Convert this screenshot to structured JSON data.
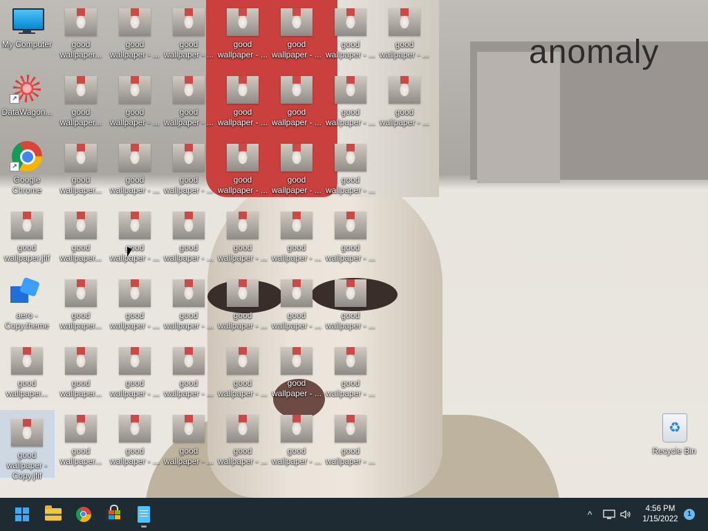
{
  "wallpaper": {
    "sign_text": "anomaly"
  },
  "desktop": {
    "special_icons": {
      "my_computer": "My Computer",
      "datawagon": "DataWagon...",
      "chrome": "Google Chrome",
      "jfif": "good wallpaper.jfif",
      "theme": "aero - Copy.theme",
      "col1_row6": "good wallpaper...",
      "col1_row7": "good wallpaper - Copy.jfif",
      "recycle_bin": "Recycle Bin"
    },
    "grid_labels": [
      [
        "good wallpaper...",
        "good wallpaper - ...",
        "good wallpaper - ...",
        "good wallpaper - ...",
        "good wallpaper - ...",
        "good wallpaper - ...",
        "good wallpaper - ..."
      ],
      [
        "good wallpaper...",
        "good wallpaper - ...",
        "good wallpaper - ...",
        "good wallpaper - ...",
        "good wallpaper - ...",
        "good wallpaper - ...",
        "good wallpaper - ..."
      ],
      [
        "good wallpaper...",
        "good wallpaper - ...",
        "good wallpaper - ...",
        "good wallpaper - ...",
        "good wallpaper - ...",
        "good wallpaper - ..."
      ],
      [
        "good wallpaper...",
        "good wallpaper - ...",
        "good wallpaper - ...",
        "good wallpaper - ...",
        "good wallpaper - ...",
        "good wallpaper - ..."
      ],
      [
        "good wallpaper...",
        "good wallpaper - ...",
        "good wallpaper - ...",
        "good wallpaper - ...",
        "good wallpaper - ...",
        "good wallpaper - ..."
      ],
      [
        "good wallpaper...",
        "good wallpaper - ...",
        "good wallpaper - ...",
        "good wallpaper - ...",
        "good wallpaper - ...",
        "good wallpaper - ..."
      ],
      [
        "good wallpaper...",
        "good wallpaper - ...",
        "good wallpaper - ...",
        "good wallpaper - ...",
        "good wallpaper - ...",
        "good wallpaper - ..."
      ]
    ]
  },
  "taskbar": {
    "apps": [
      {
        "name": "start-button",
        "icon": "windows-start-icon"
      },
      {
        "name": "file-explorer-button",
        "icon": "folder-icon"
      },
      {
        "name": "chrome-taskbar-button",
        "icon": "chrome-icon"
      },
      {
        "name": "store-button",
        "icon": "store-icon"
      },
      {
        "name": "notepad-button",
        "icon": "notepad-icon",
        "running": true
      }
    ],
    "tray": {
      "chevron": "^",
      "network_icon": "network-icon",
      "volume_icon": "volume-icon",
      "time": "4:56 PM",
      "date": "1/15/2022",
      "notification_count": "1"
    }
  },
  "colors": {
    "taskbar_bg": "#1f2b33",
    "accent": "#3fa9f5",
    "selection": "#9bbee6"
  }
}
